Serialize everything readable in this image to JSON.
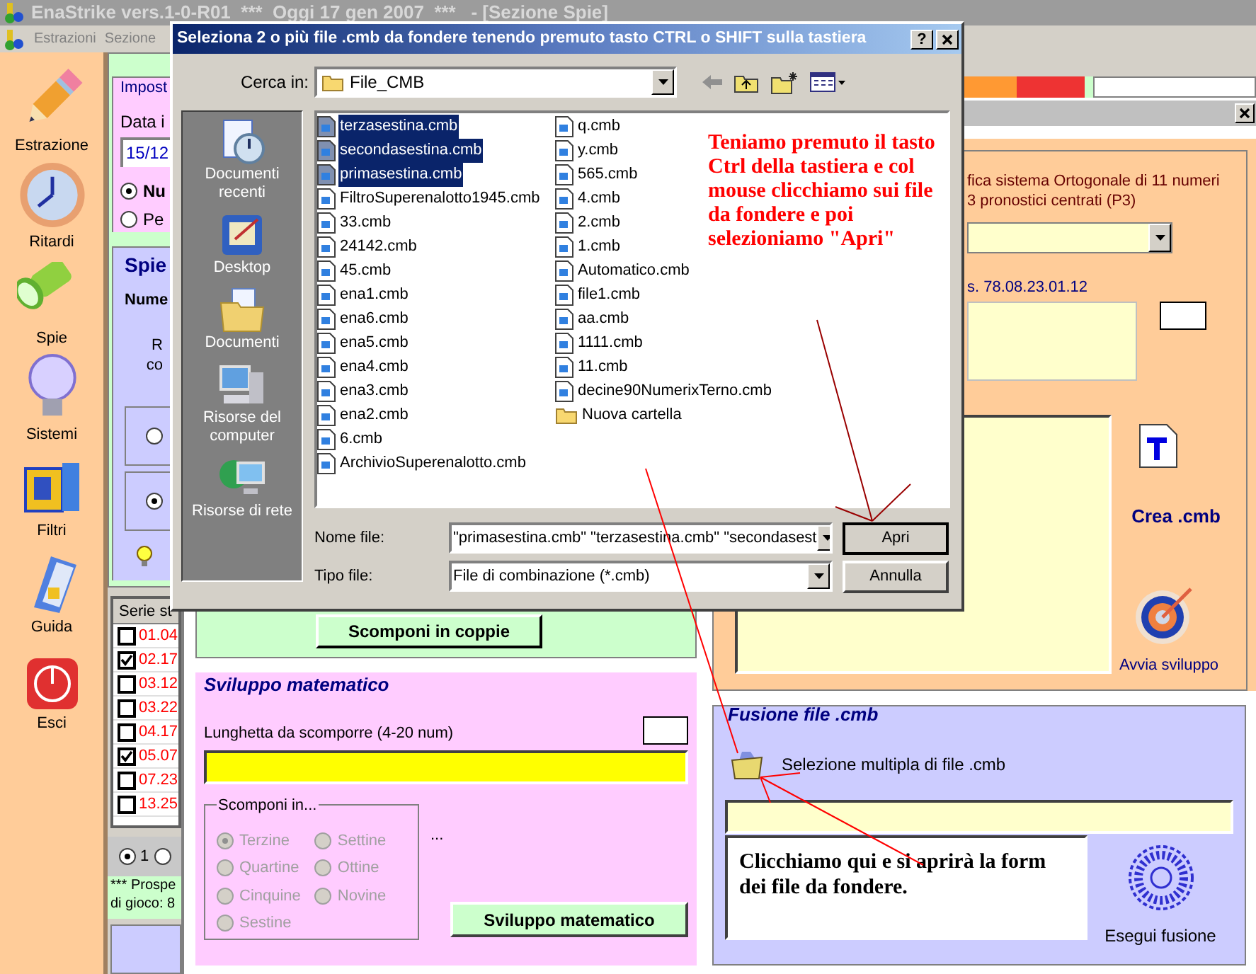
{
  "window": {
    "title": "EnaStrike vers.1-0-R01  ***  Oggi 17 gen 2007  ***   - [Sezione Spie]"
  },
  "menu": [
    "Estrazioni",
    "Sezione"
  ],
  "sidebar": {
    "items": [
      {
        "label": "Estrazione",
        "kind": "pencil"
      },
      {
        "label": "Ritardi",
        "kind": "clock"
      },
      {
        "label": "Spie",
        "kind": "flashlight"
      },
      {
        "label": "Sistemi",
        "kind": "bulb"
      },
      {
        "label": "Filtri",
        "kind": "box"
      },
      {
        "label": "Guida",
        "kind": "book"
      },
      {
        "label": "Esci",
        "kind": "power"
      }
    ]
  },
  "impostazioni": {
    "legend": "Impost",
    "date_label": "Data i",
    "date_value": "15/12",
    "options": [
      {
        "label": "Nu",
        "selected": true
      },
      {
        "label": "Pe",
        "selected": false
      }
    ]
  },
  "spie": {
    "title": "Spie",
    "label": "Nume",
    "text_lines": [
      "R",
      "co"
    ],
    "options": [
      {
        "selected": false
      },
      {
        "selected": true
      }
    ]
  },
  "series_table": {
    "header": "Serie st",
    "rows": [
      {
        "text": "01.04",
        "checked": false
      },
      {
        "text": "02.17",
        "checked": true
      },
      {
        "text": "03.12",
        "checked": false
      },
      {
        "text": "03.22",
        "checked": false
      },
      {
        "text": "04.17",
        "checked": false
      },
      {
        "text": "05.07",
        "checked": true
      },
      {
        "text": "07.23",
        "checked": false
      },
      {
        "text": "13.25",
        "checked": false
      }
    ]
  },
  "page_options": [
    {
      "label": "1",
      "selected": true
    },
    {
      "selected": false
    }
  ],
  "prospetto": [
    "*** Prospe",
    "di gioco: 8"
  ],
  "scomponi_button": "Scomponi in coppie",
  "sviluppo": {
    "legend": "Sviluppo matematico",
    "length_label": "Lunghetta da scomporre (4-20 num)",
    "group_legend": "Scomponi in...",
    "disabled": true,
    "options": [
      [
        {
          "label": "Terzine",
          "selected": true
        },
        {
          "label": "Quartine",
          "selected": false
        },
        {
          "label": "Cinquine",
          "selected": false
        },
        {
          "label": "Sestine",
          "selected": false
        }
      ],
      [
        {
          "label": "Settine",
          "selected": false
        },
        {
          "label": "Ottine",
          "selected": false
        },
        {
          "label": "Novine",
          "selected": false
        }
      ]
    ],
    "ellipsis": "...",
    "button": "Sviluppo matematico"
  },
  "dialog": {
    "title": "Seleziona 2 o più file .cmb da fondere tenendo premuto tasto CTRL o SHIFT sulla tastiera",
    "help": "?",
    "look_in_label": "Cerca in:",
    "folder": "File_CMB",
    "places": [
      {
        "label": "Documenti recenti",
        "kind": "recent"
      },
      {
        "label": "Desktop",
        "kind": "desktop"
      },
      {
        "label": "Documenti",
        "kind": "documents"
      },
      {
        "label": "Risorse del computer",
        "kind": "computer"
      },
      {
        "label": "Risorse di rete",
        "kind": "network"
      }
    ],
    "file_columns": [
      [
        {
          "name": "terzasestina.cmb",
          "kind": "file",
          "selected": true
        },
        {
          "name": "secondasestina.cmb",
          "kind": "file",
          "selected": true
        },
        {
          "name": "primasestina.cmb",
          "kind": "file",
          "selected": true
        },
        {
          "name": "FiltroSuperenalotto1945.cmb",
          "kind": "file",
          "selected": false
        },
        {
          "name": "33.cmb",
          "kind": "file",
          "selected": false
        },
        {
          "name": "24142.cmb",
          "kind": "file",
          "selected": false
        },
        {
          "name": "45.cmb",
          "kind": "file",
          "selected": false
        },
        {
          "name": "ena1.cmb",
          "kind": "file",
          "selected": false
        },
        {
          "name": "ena6.cmb",
          "kind": "file",
          "selected": false
        },
        {
          "name": "ena5.cmb",
          "kind": "file",
          "selected": false
        },
        {
          "name": "ena4.cmb",
          "kind": "file",
          "selected": false
        },
        {
          "name": "ena3.cmb",
          "kind": "file",
          "selected": false
        },
        {
          "name": "ena2.cmb",
          "kind": "file",
          "selected": false
        },
        {
          "name": "6.cmb",
          "kind": "file",
          "selected": false
        },
        {
          "name": "ArchivioSuperenalotto.cmb",
          "kind": "file",
          "selected": false
        }
      ],
      [
        {
          "name": "q.cmb",
          "kind": "file",
          "selected": false
        },
        {
          "name": "y.cmb",
          "kind": "file",
          "selected": false
        },
        {
          "name": "565.cmb",
          "kind": "file",
          "selected": false
        },
        {
          "name": "4.cmb",
          "kind": "file",
          "selected": false
        },
        {
          "name": "2.cmb",
          "kind": "file",
          "selected": false
        },
        {
          "name": "1.cmb",
          "kind": "file",
          "selected": false
        },
        {
          "name": "Automatico.cmb",
          "kind": "file",
          "selected": false
        },
        {
          "name": "file1.cmb",
          "kind": "file",
          "selected": false
        },
        {
          "name": "aa.cmb",
          "kind": "file",
          "selected": false
        },
        {
          "name": "1111.cmb",
          "kind": "file",
          "selected": false
        },
        {
          "name": "11.cmb",
          "kind": "file",
          "selected": false
        },
        {
          "name": "decine90NumerixTerno.cmb",
          "kind": "file",
          "selected": false
        },
        {
          "name": "Nuova cartella",
          "kind": "folder",
          "selected": false
        }
      ]
    ],
    "note": "Teniamo premuto il tasto Ctrl della tastiera e col mouse clicchiamo sui file da fondere e poi selezioniamo \"Apri\"",
    "file_name_label": "Nome file:",
    "file_name_value": "\"primasestina.cmb\" \"terzasestina.cmb\" \"secondasest",
    "file_type_label": "Tipo file:",
    "file_type_value": "File di combinazione (*.cmb)",
    "buttons": [
      "Apri",
      "Annulla"
    ]
  },
  "right_window": {
    "lines": [
      "fica sistema Ortogonale di 11 numeri",
      "3 pronostici centrati (P3)"
    ],
    "code": "s. 78.08.23.01.12",
    "create_label": "Crea .cmb",
    "start_label": "Avvia sviluppo"
  },
  "fusione": {
    "legend": "Fusione file .cmb",
    "select_label": "Selezione multipla di file .cmb",
    "note": "Clicchiamo qui e si aprirà la form dei file da fondere.",
    "run_label": "Esegui fusione"
  }
}
